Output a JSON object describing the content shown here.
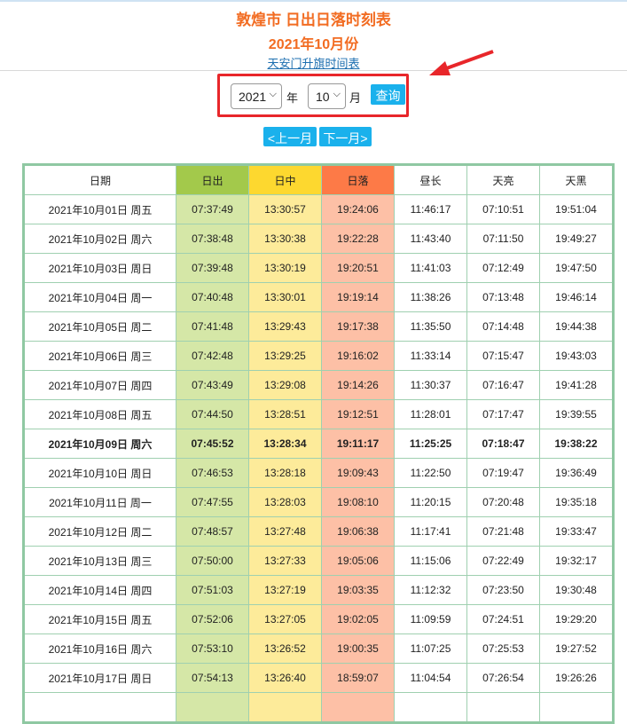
{
  "title": "敦煌市 日出日落时刻表",
  "subtitle": "2021年10月份",
  "link": "天安门升旗时间表",
  "form": {
    "year": "2021",
    "year_label": "年",
    "month": "10",
    "month_label": "月",
    "query": "查询"
  },
  "nav": {
    "prev": "<上一月",
    "next": "下一月>"
  },
  "colors": {
    "sunrise": "#a3c94b",
    "noon": "#fdd82f",
    "sunset": "#fd7a47",
    "accent": "#1ab1ec",
    "title": "#f26c22"
  },
  "table": {
    "headers": [
      "日期",
      "日出",
      "日中",
      "日落",
      "昼长",
      "天亮",
      "天黑"
    ],
    "rows": [
      [
        "2021年10月01日 周五",
        "07:37:49",
        "13:30:57",
        "19:24:06",
        "11:46:17",
        "07:10:51",
        "19:51:04"
      ],
      [
        "2021年10月02日 周六",
        "07:38:48",
        "13:30:38",
        "19:22:28",
        "11:43:40",
        "07:11:50",
        "19:49:27"
      ],
      [
        "2021年10月03日 周日",
        "07:39:48",
        "13:30:19",
        "19:20:51",
        "11:41:03",
        "07:12:49",
        "19:47:50"
      ],
      [
        "2021年10月04日 周一",
        "07:40:48",
        "13:30:01",
        "19:19:14",
        "11:38:26",
        "07:13:48",
        "19:46:14"
      ],
      [
        "2021年10月05日 周二",
        "07:41:48",
        "13:29:43",
        "19:17:38",
        "11:35:50",
        "07:14:48",
        "19:44:38"
      ],
      [
        "2021年10月06日 周三",
        "07:42:48",
        "13:29:25",
        "19:16:02",
        "11:33:14",
        "07:15:47",
        "19:43:03"
      ],
      [
        "2021年10月07日 周四",
        "07:43:49",
        "13:29:08",
        "19:14:26",
        "11:30:37",
        "07:16:47",
        "19:41:28"
      ],
      [
        "2021年10月08日 周五",
        "07:44:50",
        "13:28:51",
        "19:12:51",
        "11:28:01",
        "07:17:47",
        "19:39:55"
      ],
      [
        "2021年10月09日 周六",
        "07:45:52",
        "13:28:34",
        "19:11:17",
        "11:25:25",
        "07:18:47",
        "19:38:22"
      ],
      [
        "2021年10月10日 周日",
        "07:46:53",
        "13:28:18",
        "19:09:43",
        "11:22:50",
        "07:19:47",
        "19:36:49"
      ],
      [
        "2021年10月11日 周一",
        "07:47:55",
        "13:28:03",
        "19:08:10",
        "11:20:15",
        "07:20:48",
        "19:35:18"
      ],
      [
        "2021年10月12日 周二",
        "07:48:57",
        "13:27:48",
        "19:06:38",
        "11:17:41",
        "07:21:48",
        "19:33:47"
      ],
      [
        "2021年10月13日 周三",
        "07:50:00",
        "13:27:33",
        "19:05:06",
        "11:15:06",
        "07:22:49",
        "19:32:17"
      ],
      [
        "2021年10月14日 周四",
        "07:51:03",
        "13:27:19",
        "19:03:35",
        "11:12:32",
        "07:23:50",
        "19:30:48"
      ],
      [
        "2021年10月15日 周五",
        "07:52:06",
        "13:27:05",
        "19:02:05",
        "11:09:59",
        "07:24:51",
        "19:29:20"
      ],
      [
        "2021年10月16日 周六",
        "07:53:10",
        "13:26:52",
        "19:00:35",
        "11:07:25",
        "07:25:53",
        "19:27:52"
      ],
      [
        "2021年10月17日 周日",
        "07:54:13",
        "13:26:40",
        "18:59:07",
        "11:04:54",
        "07:26:54",
        "19:26:26"
      ]
    ],
    "highlight_row": 8
  }
}
